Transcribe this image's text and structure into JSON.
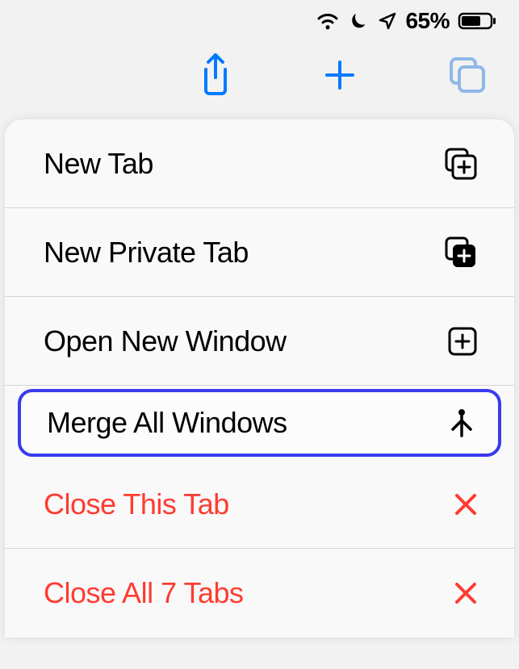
{
  "statusBar": {
    "batteryPercent": "65%"
  },
  "menu": {
    "items": [
      {
        "label": "New Tab",
        "icon": "new-tab-icon",
        "destructive": false,
        "highlighted": false
      },
      {
        "label": "New Private Tab",
        "icon": "new-private-tab-icon",
        "destructive": false,
        "highlighted": false
      },
      {
        "label": "Open New Window",
        "icon": "new-window-icon",
        "destructive": false,
        "highlighted": false
      },
      {
        "label": "Merge All Windows",
        "icon": "merge-icon",
        "destructive": false,
        "highlighted": true
      },
      {
        "label": "Close This Tab",
        "icon": "close-icon",
        "destructive": true,
        "highlighted": false
      },
      {
        "label": "Close All 7 Tabs",
        "icon": "close-icon",
        "destructive": true,
        "highlighted": false
      }
    ]
  }
}
